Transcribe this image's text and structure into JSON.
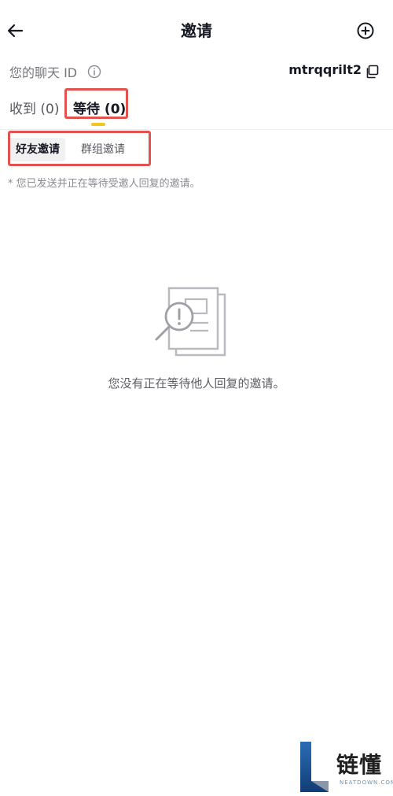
{
  "header": {
    "title": "邀请",
    "back_icon": "arrow-left-icon",
    "add_icon": "plus-circle-icon"
  },
  "chat_id": {
    "label": "您的聊天 ID",
    "info_icon": "info-circle-icon",
    "value": "mtrqqrilt2",
    "copy_icon": "copy-icon"
  },
  "tabs": {
    "received": "收到 (0)",
    "pending": "等待 (0)",
    "active": "pending",
    "indicator_color": "#f2c51f"
  },
  "segments": {
    "friend": "好友邀请",
    "group": "群组邀请",
    "active": "friend"
  },
  "note": "* 您已发送并正在等待受邀人回复的邀请。",
  "empty_state": {
    "icon": "document-magnifier-alert-icon",
    "text": "您没有正在等待他人回复的邀请。"
  },
  "highlight_color": "#e25350",
  "watermark": {
    "cn": "链懂",
    "en": "NEATDOWN.COM"
  }
}
